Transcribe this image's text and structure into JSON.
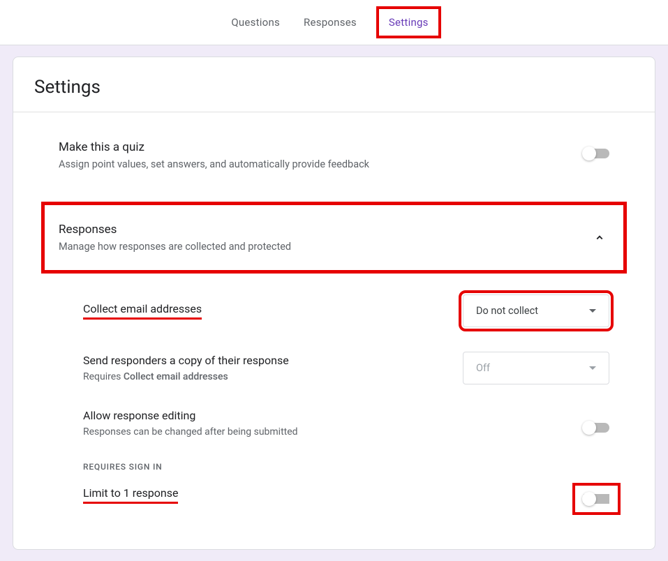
{
  "tabs": {
    "questions": "Questions",
    "responses": "Responses",
    "settings": "Settings"
  },
  "page": {
    "title": "Settings"
  },
  "quiz": {
    "title": "Make this a quiz",
    "subtitle": "Assign point values, set answers, and automatically provide feedback"
  },
  "responses_section": {
    "title": "Responses",
    "subtitle": "Manage how responses are collected and protected",
    "collect_email": {
      "label": "Collect email addresses",
      "value": "Do not collect"
    },
    "send_copy": {
      "label": "Send responders a copy of their response",
      "requires_prefix": "Requires ",
      "requires_bold": "Collect email addresses",
      "value": "Off"
    },
    "allow_editing": {
      "label": "Allow response editing",
      "subtitle": "Responses can be changed after being submitted"
    },
    "requires_signin_label": "REQUIRES SIGN IN",
    "limit_response": {
      "label": "Limit to 1 response"
    }
  }
}
